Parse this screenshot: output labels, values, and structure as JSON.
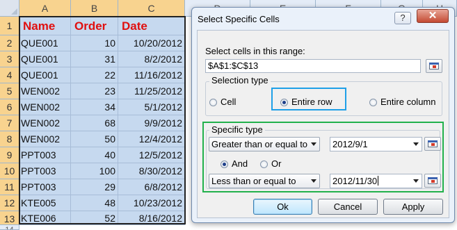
{
  "sheet": {
    "columns": [
      "A",
      "B",
      "C",
      "D",
      "E",
      "F",
      "G",
      "H"
    ],
    "row_numbers": [
      "1",
      "2",
      "3",
      "4",
      "5",
      "6",
      "7",
      "8",
      "9",
      "10",
      "11",
      "12",
      "13",
      "14"
    ],
    "header": {
      "name": "Name",
      "order": "Order",
      "date": "Date"
    },
    "rows": [
      [
        "QUE001",
        "10",
        "10/20/2012"
      ],
      [
        "QUE001",
        "31",
        "8/2/2012"
      ],
      [
        "QUE001",
        "22",
        "11/16/2012"
      ],
      [
        "WEN002",
        "23",
        "11/25/2012"
      ],
      [
        "WEN002",
        "34",
        "5/1/2012"
      ],
      [
        "WEN002",
        "68",
        "9/9/2012"
      ],
      [
        "WEN002",
        "50",
        "12/4/2012"
      ],
      [
        "PPT003",
        "40",
        "12/5/2012"
      ],
      [
        "PPT003",
        "100",
        "8/30/2012"
      ],
      [
        "PPT003",
        "29",
        "6/8/2012"
      ],
      [
        "KTE005",
        "48",
        "10/23/2012"
      ],
      [
        "KTE006",
        "52",
        "8/16/2012"
      ]
    ]
  },
  "dialog": {
    "title": "Select Specific Cells",
    "help_label": "?",
    "close_label": "✕",
    "range_label": "Select cells in this range:",
    "range_value": "$A$1:$C$13",
    "selection_type": {
      "title": "Selection type",
      "options": [
        "Cell",
        "Entire row",
        "Entire column"
      ],
      "selected": "Entire row"
    },
    "specific_type": {
      "title": "Specific type",
      "condition1": "Greater than or equal to",
      "value1": "2012/9/1",
      "logic_options": [
        "And",
        "Or"
      ],
      "logic_selected": "And",
      "condition2": "Less than or equal to",
      "value2": "2012/11/30"
    },
    "buttons": {
      "ok": "Ok",
      "cancel": "Cancel",
      "apply": "Apply"
    }
  },
  "colors": {
    "header_text": "#e01010",
    "selection_fill": "#c6d9ef",
    "highlight_blue": "#1ea0e8",
    "highlight_green": "#22b14c"
  }
}
